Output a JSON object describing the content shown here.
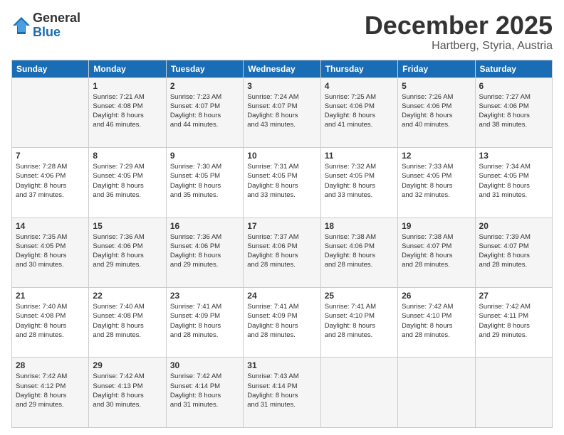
{
  "header": {
    "logo_general": "General",
    "logo_blue": "Blue",
    "month": "December 2025",
    "location": "Hartberg, Styria, Austria"
  },
  "weekdays": [
    "Sunday",
    "Monday",
    "Tuesday",
    "Wednesday",
    "Thursday",
    "Friday",
    "Saturday"
  ],
  "weeks": [
    [
      {
        "day": "",
        "info": ""
      },
      {
        "day": "1",
        "info": "Sunrise: 7:21 AM\nSunset: 4:08 PM\nDaylight: 8 hours\nand 46 minutes."
      },
      {
        "day": "2",
        "info": "Sunrise: 7:23 AM\nSunset: 4:07 PM\nDaylight: 8 hours\nand 44 minutes."
      },
      {
        "day": "3",
        "info": "Sunrise: 7:24 AM\nSunset: 4:07 PM\nDaylight: 8 hours\nand 43 minutes."
      },
      {
        "day": "4",
        "info": "Sunrise: 7:25 AM\nSunset: 4:06 PM\nDaylight: 8 hours\nand 41 minutes."
      },
      {
        "day": "5",
        "info": "Sunrise: 7:26 AM\nSunset: 4:06 PM\nDaylight: 8 hours\nand 40 minutes."
      },
      {
        "day": "6",
        "info": "Sunrise: 7:27 AM\nSunset: 4:06 PM\nDaylight: 8 hours\nand 38 minutes."
      }
    ],
    [
      {
        "day": "7",
        "info": "Sunrise: 7:28 AM\nSunset: 4:06 PM\nDaylight: 8 hours\nand 37 minutes."
      },
      {
        "day": "8",
        "info": "Sunrise: 7:29 AM\nSunset: 4:05 PM\nDaylight: 8 hours\nand 36 minutes."
      },
      {
        "day": "9",
        "info": "Sunrise: 7:30 AM\nSunset: 4:05 PM\nDaylight: 8 hours\nand 35 minutes."
      },
      {
        "day": "10",
        "info": "Sunrise: 7:31 AM\nSunset: 4:05 PM\nDaylight: 8 hours\nand 33 minutes."
      },
      {
        "day": "11",
        "info": "Sunrise: 7:32 AM\nSunset: 4:05 PM\nDaylight: 8 hours\nand 33 minutes."
      },
      {
        "day": "12",
        "info": "Sunrise: 7:33 AM\nSunset: 4:05 PM\nDaylight: 8 hours\nand 32 minutes."
      },
      {
        "day": "13",
        "info": "Sunrise: 7:34 AM\nSunset: 4:05 PM\nDaylight: 8 hours\nand 31 minutes."
      }
    ],
    [
      {
        "day": "14",
        "info": "Sunrise: 7:35 AM\nSunset: 4:05 PM\nDaylight: 8 hours\nand 30 minutes."
      },
      {
        "day": "15",
        "info": "Sunrise: 7:36 AM\nSunset: 4:06 PM\nDaylight: 8 hours\nand 29 minutes."
      },
      {
        "day": "16",
        "info": "Sunrise: 7:36 AM\nSunset: 4:06 PM\nDaylight: 8 hours\nand 29 minutes."
      },
      {
        "day": "17",
        "info": "Sunrise: 7:37 AM\nSunset: 4:06 PM\nDaylight: 8 hours\nand 28 minutes."
      },
      {
        "day": "18",
        "info": "Sunrise: 7:38 AM\nSunset: 4:06 PM\nDaylight: 8 hours\nand 28 minutes."
      },
      {
        "day": "19",
        "info": "Sunrise: 7:38 AM\nSunset: 4:07 PM\nDaylight: 8 hours\nand 28 minutes."
      },
      {
        "day": "20",
        "info": "Sunrise: 7:39 AM\nSunset: 4:07 PM\nDaylight: 8 hours\nand 28 minutes."
      }
    ],
    [
      {
        "day": "21",
        "info": "Sunrise: 7:40 AM\nSunset: 4:08 PM\nDaylight: 8 hours\nand 28 minutes."
      },
      {
        "day": "22",
        "info": "Sunrise: 7:40 AM\nSunset: 4:08 PM\nDaylight: 8 hours\nand 28 minutes."
      },
      {
        "day": "23",
        "info": "Sunrise: 7:41 AM\nSunset: 4:09 PM\nDaylight: 8 hours\nand 28 minutes."
      },
      {
        "day": "24",
        "info": "Sunrise: 7:41 AM\nSunset: 4:09 PM\nDaylight: 8 hours\nand 28 minutes."
      },
      {
        "day": "25",
        "info": "Sunrise: 7:41 AM\nSunset: 4:10 PM\nDaylight: 8 hours\nand 28 minutes."
      },
      {
        "day": "26",
        "info": "Sunrise: 7:42 AM\nSunset: 4:10 PM\nDaylight: 8 hours\nand 28 minutes."
      },
      {
        "day": "27",
        "info": "Sunrise: 7:42 AM\nSunset: 4:11 PM\nDaylight: 8 hours\nand 29 minutes."
      }
    ],
    [
      {
        "day": "28",
        "info": "Sunrise: 7:42 AM\nSunset: 4:12 PM\nDaylight: 8 hours\nand 29 minutes."
      },
      {
        "day": "29",
        "info": "Sunrise: 7:42 AM\nSunset: 4:13 PM\nDaylight: 8 hours\nand 30 minutes."
      },
      {
        "day": "30",
        "info": "Sunrise: 7:42 AM\nSunset: 4:14 PM\nDaylight: 8 hours\nand 31 minutes."
      },
      {
        "day": "31",
        "info": "Sunrise: 7:43 AM\nSunset: 4:14 PM\nDaylight: 8 hours\nand 31 minutes."
      },
      {
        "day": "",
        "info": ""
      },
      {
        "day": "",
        "info": ""
      },
      {
        "day": "",
        "info": ""
      }
    ]
  ]
}
